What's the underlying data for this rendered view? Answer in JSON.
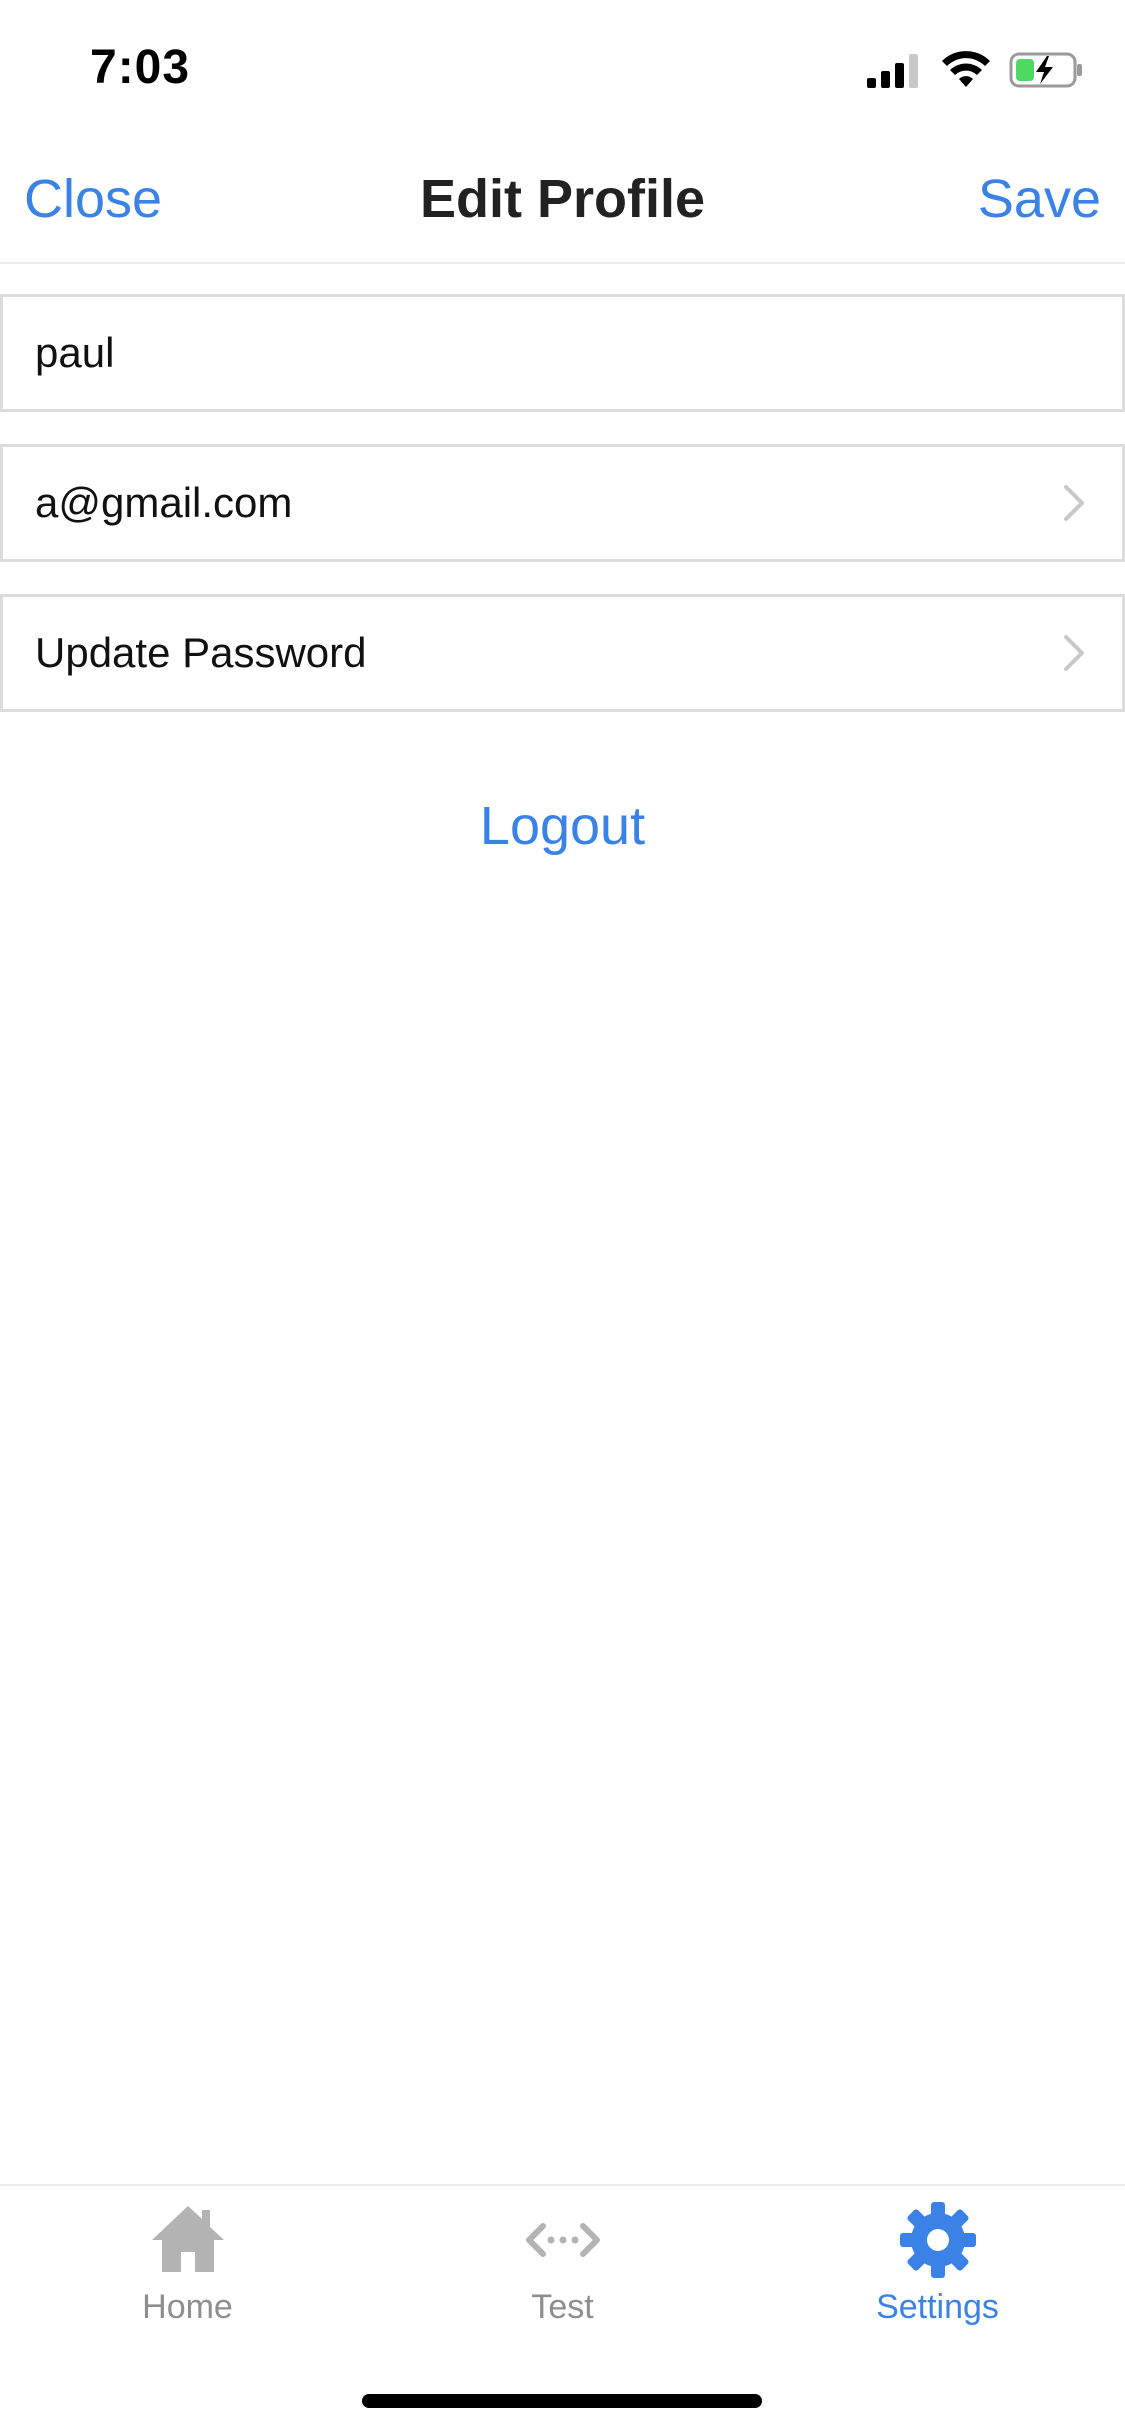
{
  "status_bar": {
    "time": "7:03"
  },
  "nav": {
    "left_label": "Close",
    "title": "Edit Profile",
    "right_label": "Save"
  },
  "form": {
    "name_value": "paul",
    "email_value": "a@gmail.com",
    "password_label": "Update Password"
  },
  "logout_label": "Logout",
  "tabs": [
    {
      "label": "Home",
      "icon": "home-icon",
      "active": false
    },
    {
      "label": "Test",
      "icon": "code-arrows-icon",
      "active": false
    },
    {
      "label": "Settings",
      "icon": "gear-icon",
      "active": true
    }
  ],
  "colors": {
    "accent": "#3b82e6",
    "inactive_tab": "#8e8e8e",
    "battery_fill": "#4cd964"
  }
}
